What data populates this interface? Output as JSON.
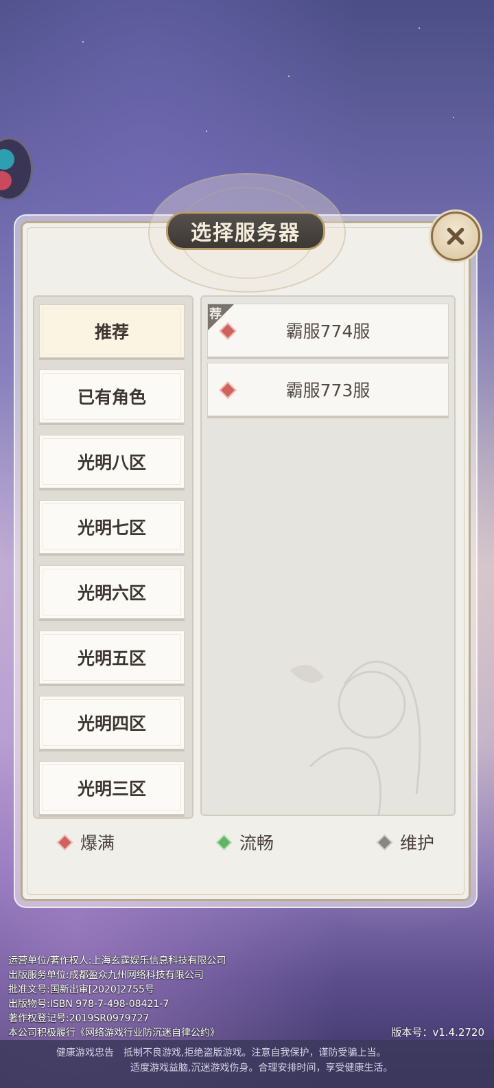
{
  "dialog": {
    "title": "选择服务器",
    "close_icon": "close-x-icon"
  },
  "categories": [
    {
      "label": "推荐",
      "active": true
    },
    {
      "label": "已有角色",
      "active": false
    },
    {
      "label": "光明八区",
      "active": false
    },
    {
      "label": "光明七区",
      "active": false
    },
    {
      "label": "光明六区",
      "active": false
    },
    {
      "label": "光明五区",
      "active": false
    },
    {
      "label": "光明四区",
      "active": false
    },
    {
      "label": "光明三区",
      "active": false
    }
  ],
  "servers": [
    {
      "name": "霸服774服",
      "status": "爆满",
      "status_color": "#d0625e",
      "badge": "荐"
    },
    {
      "name": "霸服773服",
      "status": "爆满",
      "status_color": "#d0625e",
      "badge": ""
    }
  ],
  "legend": [
    {
      "label": "爆满",
      "color": "#d0625e"
    },
    {
      "label": "流畅",
      "color": "#5fb562"
    },
    {
      "label": "维护",
      "color": "#8a8682"
    }
  ],
  "footer": {
    "line1": "运营单位/著作权人:上海玄霆娱乐信息科技有限公司",
    "line2": "出版服务单位:成都盈众九州网络科技有限公司",
    "line3": "批准文号:国新出审[2020]2755号",
    "line4": "出版物号:ISBN 978-7-498-08421-7",
    "line5": "著作权登记号:2019SR0979727",
    "line6": "本公司积极履行《网络游戏行业防沉迷自律公约》",
    "version": "版本号：v1.4.2720",
    "health1": "健康游戏忠告　抵制不良游戏,拒绝盗版游戏。注意自我保护，谨防受骗上当。",
    "health2": "适度游戏益脑,沉迷游戏伤身。合理安排时间，享受健康生活。"
  }
}
